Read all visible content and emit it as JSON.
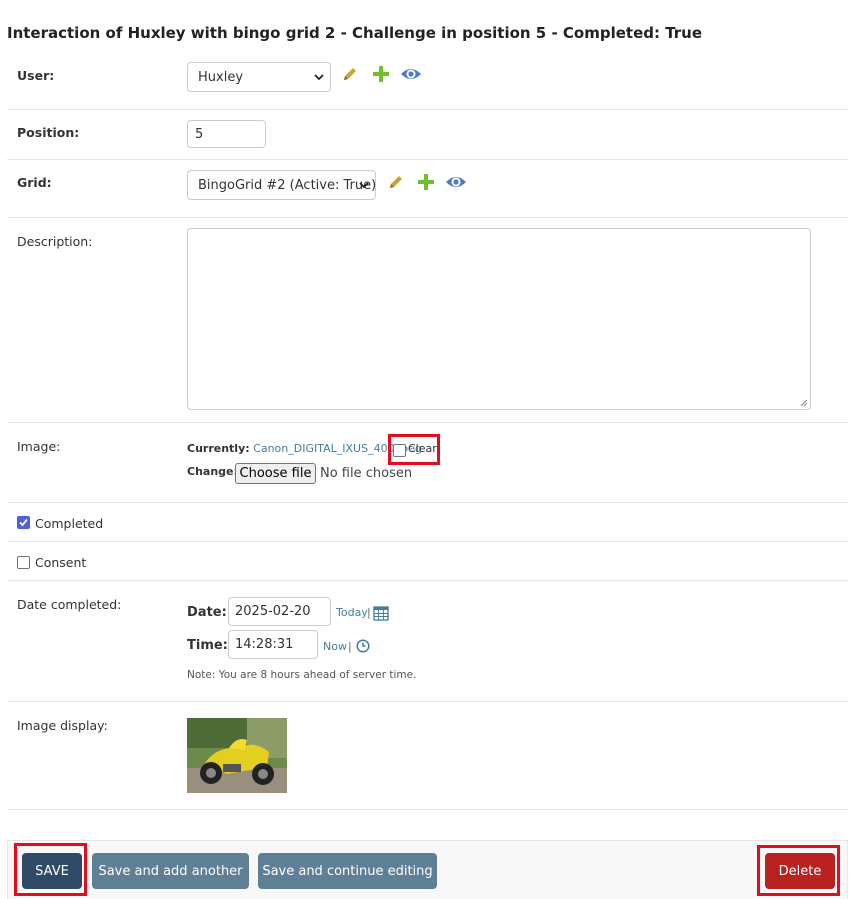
{
  "title": "Interaction of Huxley with bingo grid 2 - Challenge in position 5 - Completed: True",
  "user": {
    "label": "User:",
    "value": "Huxley"
  },
  "position": {
    "label": "Position:",
    "value": "5"
  },
  "grid": {
    "label": "Grid:",
    "value": "BingoGrid #2 (Active: True)"
  },
  "description": {
    "label": "Description:",
    "value": ""
  },
  "image": {
    "label": "Image:",
    "currently_label": "Currently:",
    "current_file": "Canon_DIGITAL_IXUS_400.jpeg",
    "clear_label": "Clear",
    "change_label": "Change:",
    "choose_button": "Choose file",
    "no_file": "No file chosen"
  },
  "completed": {
    "label": "Completed",
    "checked": true
  },
  "consent": {
    "label": "Consent",
    "checked": false
  },
  "date_completed": {
    "label": "Date completed:",
    "date_label": "Date:",
    "date_value": "2025-02-20",
    "today_link": "Today",
    "separator": "|",
    "time_label": "Time:",
    "time_value": "14:28:31",
    "now_link": "Now",
    "note": "Note: You are 8 hours ahead of server time."
  },
  "image_display": {
    "label": "Image display:"
  },
  "buttons": {
    "save": "SAVE",
    "save_add": "Save and add another",
    "save_continue": "Save and continue editing",
    "delete": "Delete"
  },
  "colors": {
    "primary_button": "#417690",
    "secondary_button": "#5f7f96",
    "delete_button": "#ba2121",
    "highlight": "#e30b1c",
    "link": "#447e9b",
    "checkbox_checked": "#4b63d6"
  }
}
